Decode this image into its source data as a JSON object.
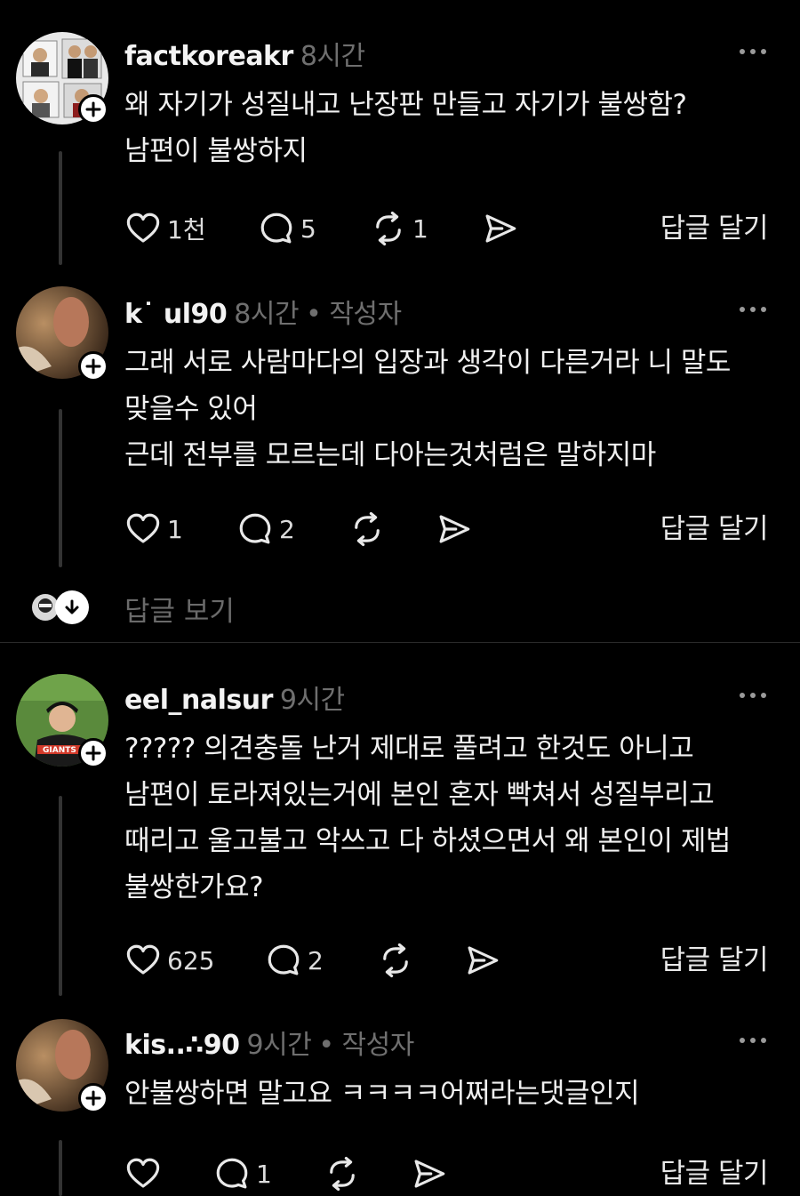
{
  "posts": [
    {
      "username": "factkoreakr",
      "time": "8시간",
      "author_tag": "",
      "text": "왜 자기가 성질내고 난장판 만들고 자기가 불쌍함?\n남편이 불쌍하지",
      "likes": "1천",
      "comments": "5",
      "reposts": "1",
      "reply_label": "답글 달기"
    },
    {
      "username": "k˙   ul90",
      "time": "8시간",
      "author_tag": "• 작성자",
      "text": "그래 서로 사람마다의 입장과 생각이 다른거라 니 말도\n맞을수 있어\n근데 전부를 모르는데 다아는것처럼은 말하지마",
      "likes": "1",
      "comments": "2",
      "reposts": "",
      "reply_label": "답글 달기"
    },
    {
      "username": "eel_nalsur",
      "time": "9시간",
      "author_tag": "",
      "text": "????? 의견충돌 난거 제대로 풀려고 한것도 아니고\n남편이 토라져있는거에 본인 혼자 빡쳐서 성질부리고\n때리고 울고불고 악쓰고 다 하셨으면서 왜 본인이 제법\n불쌍한가요?",
      "likes": "625",
      "comments": "2",
      "reposts": "",
      "reply_label": "답글 달기"
    },
    {
      "username": "kis..∴90",
      "time": "9시간",
      "author_tag": "• 작성자",
      "text": "안불쌍하면 말고요 ㅋㅋㅋㅋ어쩌라는댓글인지",
      "likes": "",
      "comments": "1",
      "reposts": "",
      "reply_label": "답글 달기"
    }
  ],
  "view_replies_label": "답글 보기",
  "icons": [
    "heart-icon",
    "comment-icon",
    "repost-icon",
    "share-icon",
    "more-icon",
    "follow-plus-icon",
    "arrow-down-icon"
  ],
  "colors": {
    "background": "#000000",
    "text": "#f3f3f3",
    "muted": "#6f6f6f",
    "line": "#333333"
  }
}
